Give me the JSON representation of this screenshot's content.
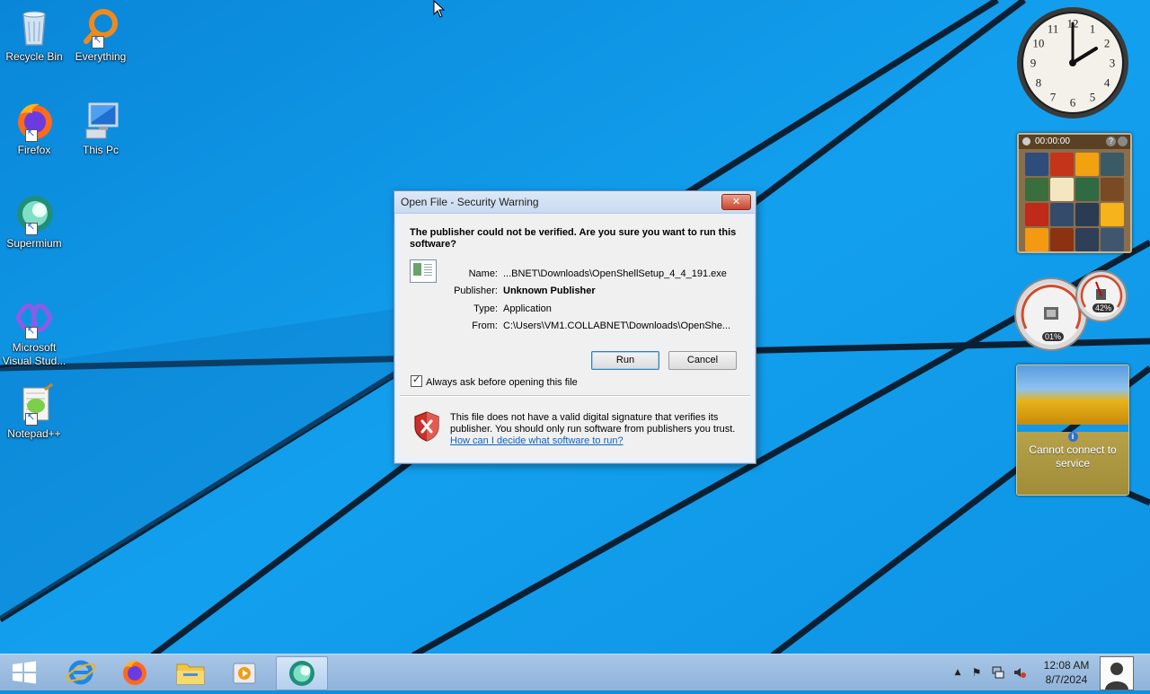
{
  "desktop": {
    "icons": [
      {
        "label": "Recycle Bin",
        "icon": "recycle-bin-icon"
      },
      {
        "label": "Everything",
        "icon": "everything-search-icon"
      },
      {
        "label": "Firefox",
        "icon": "firefox-icon"
      },
      {
        "label": "This Pc",
        "icon": "computer-icon"
      },
      {
        "label": "Supermium",
        "icon": "supermium-icon"
      },
      {
        "label": "Microsoft\nVisual Stud...",
        "icon": "visual-studio-icon"
      },
      {
        "label": "Notepad++",
        "icon": "notepad-plus-plus-icon"
      }
    ]
  },
  "gadgets": {
    "clock": {
      "numbers": [
        "12",
        "1",
        "2",
        "3",
        "4",
        "5",
        "6",
        "7",
        "8",
        "9",
        "10",
        "11"
      ]
    },
    "puzzle": {
      "timer": "00:00:00"
    },
    "meter": {
      "cpu": "01%",
      "memory": "42%"
    },
    "weather": {
      "message": "Cannot connect to service"
    }
  },
  "dialog": {
    "title": "Open File - Security Warning",
    "close_label": "✕",
    "headline": "The publisher could not be verified.  Are you sure you want to run this software?",
    "fields": [
      {
        "key": "Name:",
        "value": "...BNET\\Downloads\\OpenShellSetup_4_4_191.exe",
        "bold": false
      },
      {
        "key": "Publisher:",
        "value": "Unknown Publisher",
        "bold": true
      },
      {
        "key": "Type:",
        "value": "Application",
        "bold": false
      },
      {
        "key": "From:",
        "value": "C:\\Users\\VM1.COLLABNET\\Downloads\\OpenShe...",
        "bold": false
      }
    ],
    "run_label": "Run",
    "cancel_label": "Cancel",
    "checkbox_label": "Always ask before opening this file",
    "checkbox_checked": true,
    "warning_text": "This file does not have a valid digital signature that verifies its publisher.  You should only run software from publishers you trust.",
    "warning_link": "How can I decide what software to run?"
  },
  "taskbar": {
    "pinned": [
      "start-button",
      "internet-explorer-icon",
      "firefox-icon",
      "file-explorer-icon",
      "media-player-icon",
      "supermium-icon"
    ],
    "time": "12:08 AM",
    "date": "8/7/2024"
  },
  "colors": {
    "wallpaper": "#0f8fdc",
    "taskbar": "#9dbde2",
    "link": "#0a62c9"
  }
}
